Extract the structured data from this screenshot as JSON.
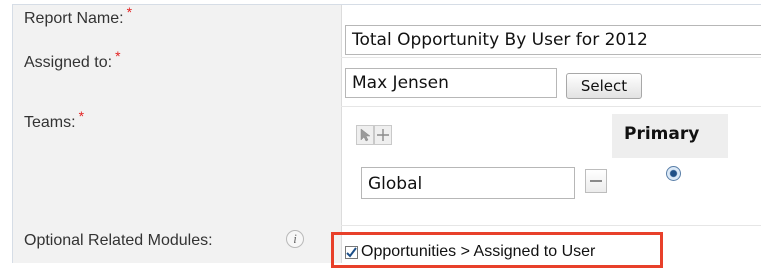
{
  "form": {
    "report_name": {
      "label": "Report Name:",
      "required_mark": "*",
      "value": "Total Opportunity By User for 2012"
    },
    "assigned_to": {
      "label": "Assigned to:",
      "required_mark": "*",
      "value": "Max Jensen",
      "select_label": "Select"
    },
    "teams": {
      "label": "Teams:",
      "required_mark": "*",
      "primary_label": "Primary",
      "team_value": "Global",
      "primary_selected": true
    },
    "optional_modules": {
      "label": "Optional Related Modules:",
      "info_glyph": "i",
      "module_label": "Opportunities > Assigned to User",
      "checked": true
    }
  },
  "colors": {
    "highlight": "#e8402a",
    "required": "#e32222",
    "radio": "#1f4f86"
  },
  "icons": [
    "arrow-cursor-icon",
    "plus-icon",
    "minus-icon",
    "info-icon",
    "checkmark-icon"
  ]
}
